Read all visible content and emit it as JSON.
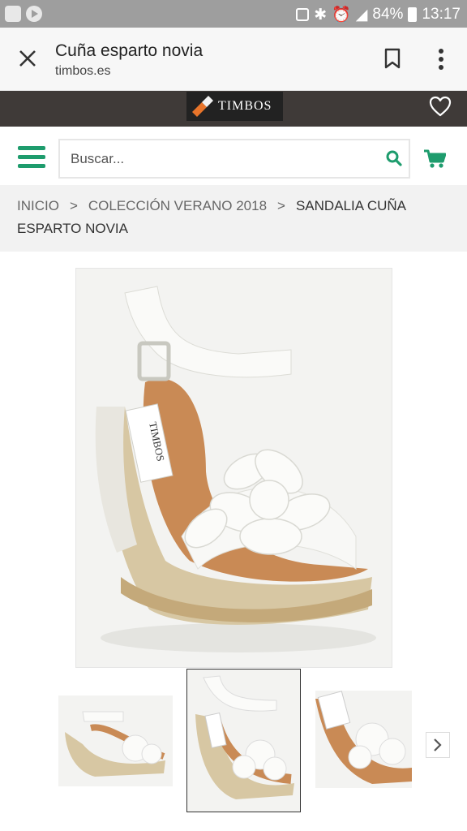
{
  "status_bar": {
    "battery": "84%",
    "time": "13:17"
  },
  "browser": {
    "title": "Cuña esparto novia",
    "domain": "timbos.es"
  },
  "brand": {
    "logo_text": "TIMBOS"
  },
  "search": {
    "placeholder": "Buscar..."
  },
  "breadcrumb": {
    "items": [
      "INICIO",
      "COLECCIÓN VERANO 2018"
    ],
    "current": "SANDALIA CUÑA ESPARTO NOVIA",
    "separator": ">"
  },
  "product": {
    "image_tag": "TIMBOS"
  },
  "colors": {
    "accent": "#1e9c6d",
    "brand_bar": "#3f3a38",
    "status_bar": "#9e9e9e"
  }
}
